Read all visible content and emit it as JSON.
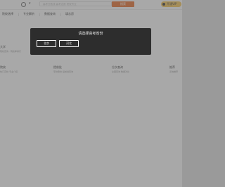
{
  "header": {
    "search_placeholder": "高考分数线 高考志愿 院校专业",
    "search_button": "搜索",
    "user_label": "开通VIP"
  },
  "nav": {
    "items": [
      "院校选择",
      "专业解析",
      "数据查询",
      "填志愿"
    ]
  },
  "content": {
    "cards": [
      {
        "title": "大学",
        "subtitle": "院校查询 · 院校库排行"
      },
      {
        "title": "排名",
        "subtitle": "全国排名"
      },
      {
        "title": "院校",
        "subtitle": "热门高校 专业介绍"
      },
      {
        "title": "提前批",
        "subtitle": "军校警校 提前批查询"
      },
      {
        "title": "位次查询",
        "subtitle": "全国查询 数据对比"
      },
      {
        "title": "推荐",
        "subtitle": "系统推荐"
      }
    ]
  },
  "modal": {
    "title": "请选择高考省份",
    "confirm_label": "北京",
    "secondary_label": "河北"
  }
}
